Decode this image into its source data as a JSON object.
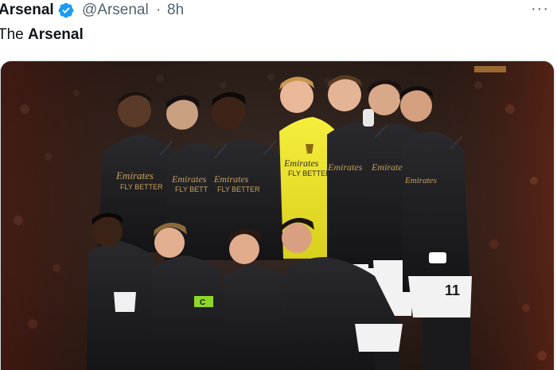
{
  "tweet": {
    "author_name": "Arsenal",
    "handle": "@Arsenal",
    "separator": "·",
    "time": "8h",
    "more_label": "···",
    "text_prefix": "The ",
    "text_bold": "Arsenal"
  },
  "icons": {
    "verified": "verified-badge-icon",
    "more": "more-options-icon"
  },
  "colors": {
    "verified_blue": "#1d9bf0",
    "text_primary": "#0f1419",
    "text_secondary": "#536471",
    "kit_black": "#1a1a1c",
    "keeper_yellow": "#f3e82a",
    "sponsor_gold": "#c9a25a"
  },
  "media": {
    "sponsor_line1": "Emirates",
    "sponsor_line2": "FLY BETTER",
    "armband": "C",
    "shorts_number": "11"
  }
}
